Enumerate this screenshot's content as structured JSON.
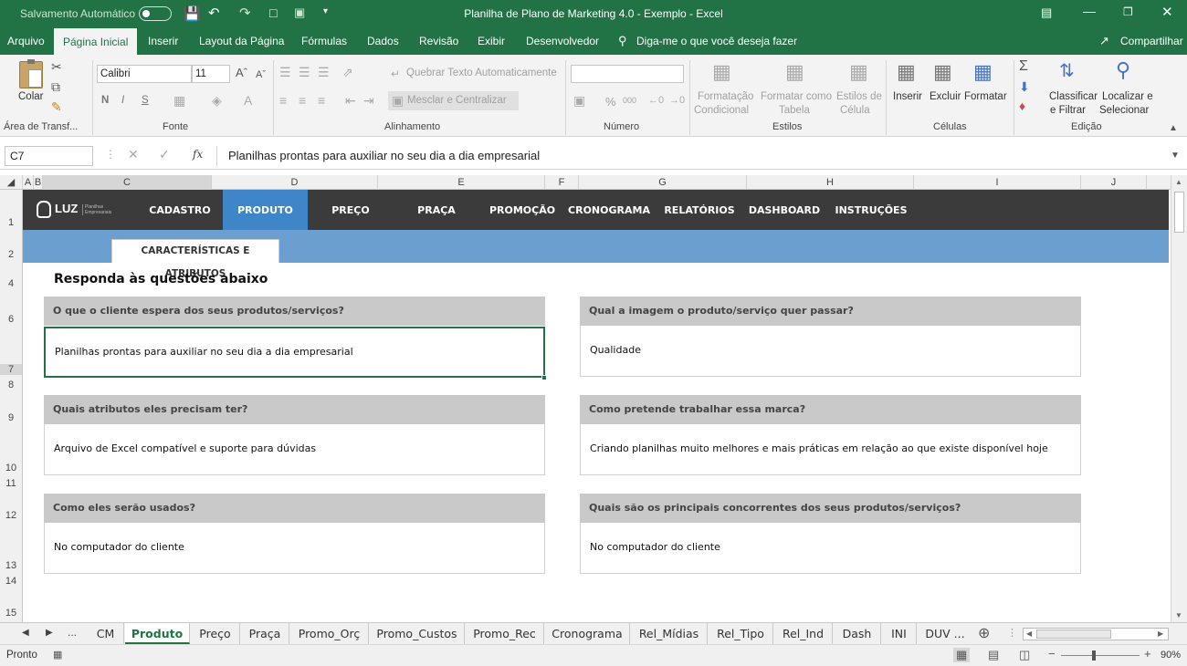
{
  "titlebar": {
    "autosave_label": "Salvamento Automático",
    "autosave_state": "Desativado",
    "title": "Planilha de Plano de Marketing 4.0 - Exemplo  -  Excel"
  },
  "ribbon_tabs": [
    "Arquivo",
    "Página Inicial",
    "Inserir",
    "Layout da Página",
    "Fórmulas",
    "Dados",
    "Revisão",
    "Exibir",
    "Desenvolvedor"
  ],
  "tell_me": "Diga-me o que você deseja fazer",
  "share": "Compartilhar",
  "ribbon": {
    "paste": "Colar",
    "clipboard": "Área de Transf...",
    "font_name": "Calibri",
    "font_size": "11",
    "bold": "N",
    "italic": "I",
    "underline": "S",
    "font_group": "Fonte",
    "wrap_text": "Quebrar Texto Automaticamente",
    "merge": "Mesclar e Centralizar",
    "alignment_group": "Alinhamento",
    "percent": "%",
    "thousands": "000",
    "number_group": "Número",
    "cond_format_1": "Formatação",
    "cond_format_2": "Condicional",
    "format_table_1": "Formatar como",
    "format_table_2": "Tabela",
    "cell_styles_1": "Estilos de",
    "cell_styles_2": "Célula",
    "styles_group": "Estilos",
    "insert": "Inserir",
    "delete": "Excluir",
    "format": "Formatar",
    "cells_group": "Células",
    "sort_1": "Classificar",
    "sort_2": "e Filtrar",
    "find_1": "Localizar e",
    "find_2": "Selecionar",
    "editing_group": "Edição"
  },
  "formula_bar": {
    "name_box": "C7",
    "fx": "fx",
    "content": "Planilhas prontas para auxiliar no seu dia a dia empresarial"
  },
  "columns": [
    "A",
    "B",
    "C",
    "D",
    "E",
    "F",
    "G",
    "H",
    "I",
    "J"
  ],
  "rows": [
    "1",
    "2",
    "4",
    "6",
    "7",
    "8",
    "9",
    "10",
    "11",
    "12",
    "13",
    "14",
    "15"
  ],
  "banner": {
    "logo": "LUZ",
    "logo_sub": "Planilhas Empresariais",
    "nav": [
      "CADASTRO",
      "PRODUTO",
      "PREÇO",
      "PRAÇA",
      "PROMOÇÃO",
      "CRONOGRAMA",
      "RELATÓRIOS",
      "DASHBOARD",
      "INSTRUÇÕES"
    ],
    "active_nav": "PRODUTO",
    "subtab": "CARACTERÍSTICAS E ATRIBUTOS"
  },
  "heading": "Responda às questões abaixo",
  "cards": [
    {
      "question": "O que o cliente espera dos seus produtos/serviços?",
      "answer": "Planilhas prontas para auxiliar no seu dia a dia empresarial"
    },
    {
      "question": "Qual a imagem o produto/serviço quer passar?",
      "answer": "Qualidade"
    },
    {
      "question": "Quais atributos eles precisam ter?",
      "answer": "Arquivo de Excel compatível e suporte para dúvidas"
    },
    {
      "question": "Como pretende trabalhar essa marca?",
      "answer": "Criando planilhas muito melhores e mais práticas em relação ao que existe disponível hoje"
    },
    {
      "question": "Como eles serão usados?",
      "answer": "No computador do cliente"
    },
    {
      "question": "Quais são os principais concorrentes dos seus produtos/serviços?",
      "answer": "No computador do cliente"
    }
  ],
  "sheet_tabs": [
    "CM",
    "Produto",
    "Preço",
    "Praça",
    "Promo_Orç",
    "Promo_Custos",
    "Promo_Rec",
    "Cronograma",
    "Rel_Mídias",
    "Rel_Tipo",
    "Rel_Ind",
    "Dash",
    "INI",
    "DUV ..."
  ],
  "active_sheet": "Produto",
  "status": {
    "ready": "Pronto",
    "zoom": "90%"
  },
  "colors": {
    "excel_green": "#217346",
    "banner_dark": "#3b3b3b",
    "accent_blue": "#3f86c9",
    "strip_blue": "#6a9fd0",
    "question_gray": "#c9c9c9"
  }
}
